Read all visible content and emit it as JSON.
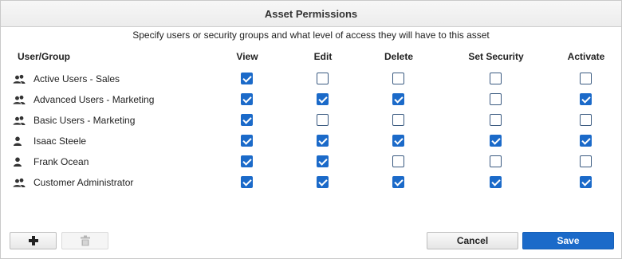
{
  "dialog": {
    "title": "Asset Permissions",
    "subtitle": "Specify users or security groups and what level of access they will have to this asset"
  },
  "columns": {
    "user_group": "User/Group",
    "view": "View",
    "edit": "Edit",
    "delete": "Delete",
    "set_security": "Set Security",
    "activate": "Activate"
  },
  "rows": [
    {
      "name": "Active Users - Sales",
      "type": "group",
      "icon": "group-icon",
      "view": true,
      "edit": false,
      "delete": false,
      "set_security": false,
      "activate": false
    },
    {
      "name": "Advanced Users - Marketing",
      "type": "group",
      "icon": "group-icon",
      "view": true,
      "edit": true,
      "delete": true,
      "set_security": false,
      "activate": true
    },
    {
      "name": "Basic Users - Marketing",
      "type": "group",
      "icon": "group-icon",
      "view": true,
      "edit": false,
      "delete": false,
      "set_security": false,
      "activate": false
    },
    {
      "name": "Isaac Steele",
      "type": "user",
      "icon": "user-icon",
      "view": true,
      "edit": true,
      "delete": true,
      "set_security": true,
      "activate": true
    },
    {
      "name": "Frank Ocean",
      "type": "user",
      "icon": "user-icon",
      "view": true,
      "edit": true,
      "delete": false,
      "set_security": false,
      "activate": false
    },
    {
      "name": "Customer Administrator",
      "type": "group",
      "icon": "group-icon",
      "view": true,
      "edit": true,
      "delete": true,
      "set_security": true,
      "activate": true
    }
  ],
  "footer": {
    "add_icon": "plus-icon",
    "delete_icon": "trash-icon",
    "cancel_label": "Cancel",
    "save_label": "Save"
  },
  "colors": {
    "accent": "#1b6ac9",
    "checkbox_border": "#3a5a80"
  }
}
